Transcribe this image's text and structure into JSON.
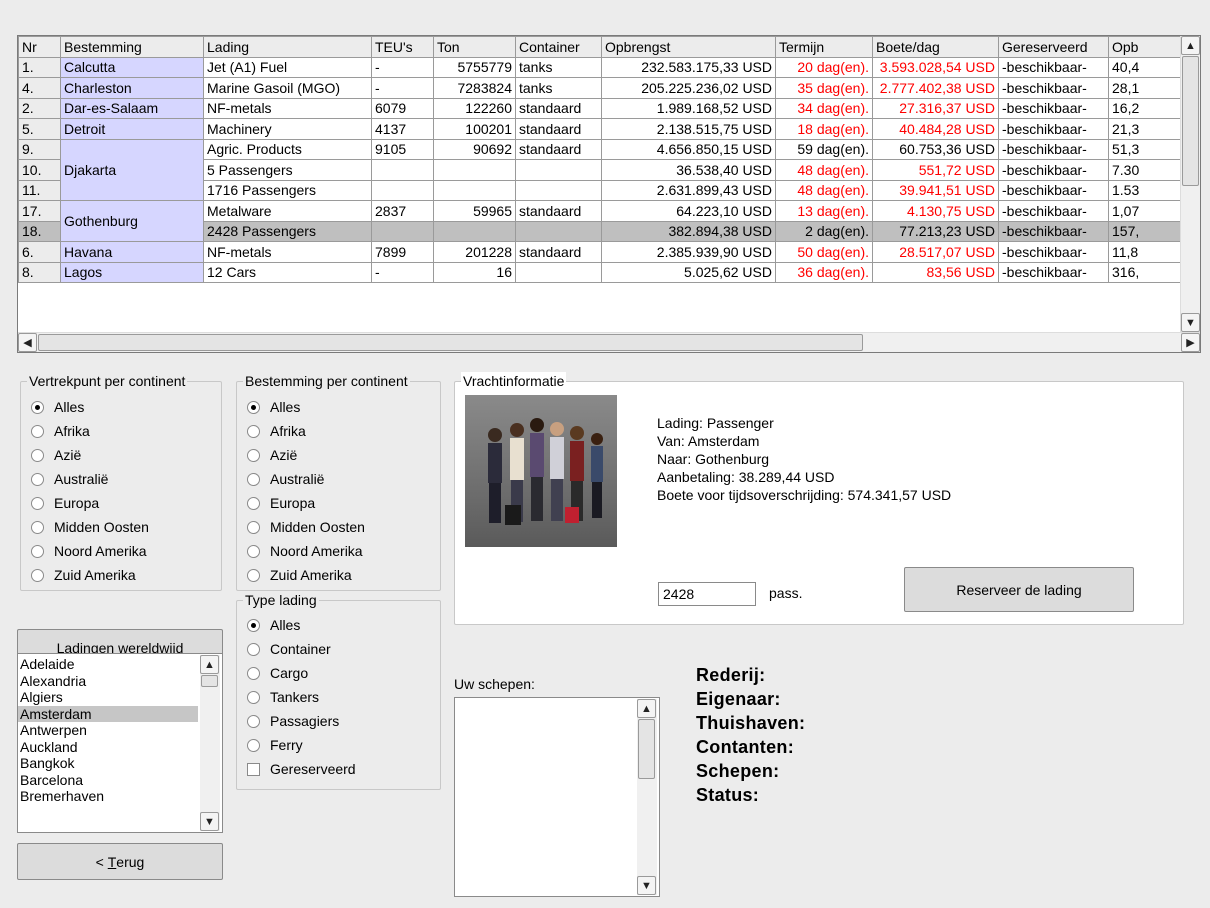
{
  "grid": {
    "headers": [
      "Nr",
      "Bestemming",
      "Lading",
      "TEU's",
      "Ton",
      "Container",
      "Opbrengst",
      "Termijn",
      "Boete/dag",
      "Gereserveerd",
      "Opb"
    ],
    "rows": [
      {
        "nr": "1.",
        "dest": "Calcutta",
        "lading": "Jet (A1) Fuel",
        "teu": "-",
        "ton": "5755779",
        "container": "tanks",
        "opbrengst": "232.583.175,33 USD",
        "termijn": "20 dag(en).",
        "boete": "3.593.028,54 USD",
        "gereserveerd": "-beschikbaar-",
        "opb": "40,4"
      },
      {
        "nr": "4.",
        "dest": "Charleston",
        "lading": "Marine Gasoil (MGO)",
        "teu": "-",
        "ton": "7283824",
        "container": "tanks",
        "opbrengst": "205.225.236,02 USD",
        "termijn": "35 dag(en).",
        "boete": "2.777.402,38 USD",
        "gereserveerd": "-beschikbaar-",
        "opb": "28,1"
      },
      {
        "nr": "2.",
        "dest": "Dar-es-Salaam",
        "lading": "NF-metals",
        "teu": "6079",
        "ton": "122260",
        "container": "standaard",
        "opbrengst": "1.989.168,52 USD",
        "termijn": "34 dag(en).",
        "boete": "27.316,37 USD",
        "gereserveerd": "-beschikbaar-",
        "opb": "16,2"
      },
      {
        "nr": "5.",
        "dest": "Detroit",
        "lading": "Machinery",
        "teu": "4137",
        "ton": "100201",
        "container": "standaard",
        "opbrengst": "2.138.515,75 USD",
        "termijn": "18 dag(en).",
        "boete": "40.484,28 USD",
        "gereserveerd": "-beschikbaar-",
        "opb": "21,3"
      },
      {
        "nr": "9.",
        "dest": "Djakarta",
        "lading": "Agric. Products",
        "teu": "9105",
        "ton": "90692",
        "container": "standaard",
        "opbrengst": "4.656.850,15 USD",
        "termijn": "59 dag(en).",
        "boete": "60.753,36 USD",
        "gereserveerd": "-beschikbaar-",
        "opb": "51,3"
      },
      {
        "nr": "10.",
        "dest": "",
        "lading": "5 Passengers",
        "teu": "",
        "ton": "",
        "container": "",
        "opbrengst": "36.538,40 USD",
        "termijn": "48 dag(en).",
        "boete": "551,72 USD",
        "gereserveerd": "-beschikbaar-",
        "opb": "7.30"
      },
      {
        "nr": "11.",
        "dest": "",
        "lading": "1716 Passengers",
        "teu": "",
        "ton": "",
        "container": "",
        "opbrengst": "2.631.899,43 USD",
        "termijn": "48 dag(en).",
        "boete": "39.941,51 USD",
        "gereserveerd": "-beschikbaar-",
        "opb": "1.53"
      },
      {
        "nr": "17.",
        "dest": "Gothenburg",
        "lading": "Metalware",
        "teu": "2837",
        "ton": "59965",
        "container": "standaard",
        "opbrengst": "64.223,10 USD",
        "termijn": "13 dag(en).",
        "boete": "4.130,75 USD",
        "gereserveerd": "-beschikbaar-",
        "opb": "1,07"
      },
      {
        "nr": "18.",
        "dest": "",
        "lading": "2428 Passengers",
        "teu": "",
        "ton": "",
        "container": "",
        "opbrengst": "382.894,38 USD",
        "termijn": "2 dag(en).",
        "boete": "77.213,23 USD",
        "gereserveerd": "-beschikbaar-",
        "opb": "157,"
      },
      {
        "nr": "6.",
        "dest": "Havana",
        "lading": "NF-metals",
        "teu": "7899",
        "ton": "201228",
        "container": "standaard",
        "opbrengst": "2.385.939,90 USD",
        "termijn": "50 dag(en).",
        "boete": "28.517,07 USD",
        "gereserveerd": "-beschikbaar-",
        "opb": "11,8"
      },
      {
        "nr": "8.",
        "dest": "Lagos",
        "lading": "12 Cars",
        "teu": "-",
        "ton": "16",
        "container": "",
        "opbrengst": "5.025,62 USD",
        "termijn": "36 dag(en).",
        "boete": "83,56 USD",
        "gereserveerd": "-beschikbaar-",
        "opb": "316,"
      }
    ],
    "termijn_colors": [
      "#ff0000",
      "#ff0000",
      "#ff0000",
      "#ff0000",
      "#000000",
      "#ff0000",
      "#ff0000",
      "#ff0000",
      "#000000",
      "#ff0000",
      "#ff0000"
    ],
    "boete_colors": [
      "#ff0000",
      "#ff0000",
      "#ff0000",
      "#ff0000",
      "#000000",
      "#ff0000",
      "#ff0000",
      "#ff0000",
      "#000000",
      "#ff0000",
      "#ff0000"
    ],
    "selected_row": 8
  },
  "vertrek": {
    "title": "Vertrekpunt per continent",
    "options": [
      "Alles",
      "Afrika",
      "Azië",
      "Australië",
      "Europa",
      "Midden Oosten",
      "Noord Amerika",
      "Zuid Amerika"
    ],
    "selected": 0
  },
  "bestemming": {
    "title": "Bestemming per continent",
    "options": [
      "Alles",
      "Afrika",
      "Azië",
      "Australië",
      "Europa",
      "Midden Oosten",
      "Noord Amerika",
      "Zuid Amerika"
    ],
    "selected": 0
  },
  "type_lading": {
    "title": "Type lading",
    "options": [
      "Alles",
      "Container",
      "Cargo",
      "Tankers",
      "Passagiers",
      "Ferry"
    ],
    "selected": 0,
    "checkbox_label": "Gereserveerd"
  },
  "ladingen_button": "Ladingen wereldwijd",
  "cities": {
    "items": [
      "Adelaide",
      "Alexandria",
      "Algiers",
      "Amsterdam",
      "Antwerpen",
      "Auckland",
      "Bangkok",
      "Barcelona",
      "Bremerhaven"
    ],
    "selected": 3
  },
  "terug_button": {
    "prefix": "< ",
    "mnemonic": "T",
    "rest": "erug"
  },
  "vracht": {
    "title": "Vrachtinformatie",
    "lines": [
      "Lading: Passenger",
      "Van: Amsterdam",
      "Naar: Gothenburg",
      "Aanbetaling: 38.289,44 USD",
      "Boete voor tijdsoverschrijding: 574.341,57 USD"
    ],
    "amount_value": "2428",
    "unit": "pass.",
    "reserve_button": "Reserveer de lading"
  },
  "schepen": {
    "label": "Uw schepen:"
  },
  "info": {
    "labels": [
      "Rederij:",
      "Eigenaar:",
      "Thuishaven:",
      "Contanten:",
      "Schepen:",
      "Status:"
    ]
  }
}
